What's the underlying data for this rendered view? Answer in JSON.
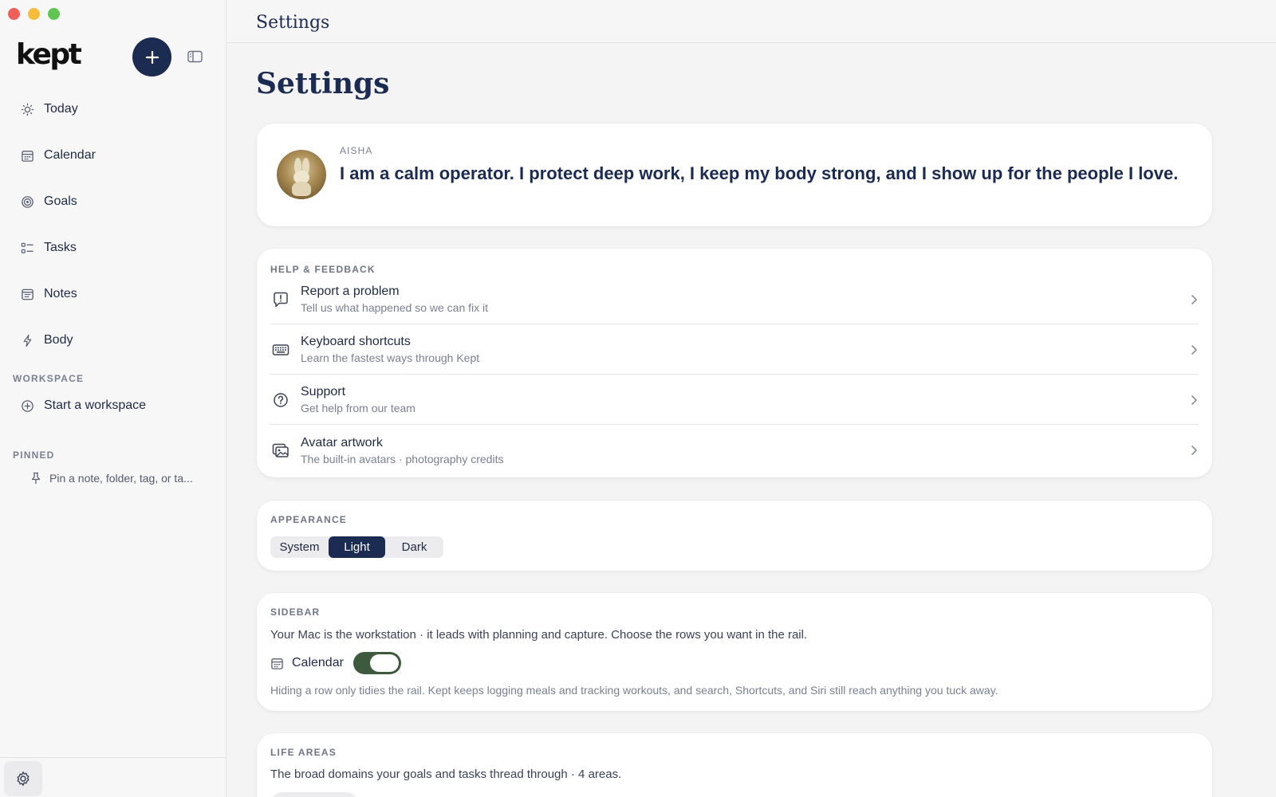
{
  "sidebar": {
    "logo": "kept",
    "nav": [
      {
        "label": "Today",
        "icon": "sun-icon"
      },
      {
        "label": "Calendar",
        "icon": "calendar-icon"
      },
      {
        "label": "Goals",
        "icon": "target-icon"
      },
      {
        "label": "Tasks",
        "icon": "tasks-icon"
      },
      {
        "label": "Notes",
        "icon": "notes-icon"
      },
      {
        "label": "Body",
        "icon": "bolt-icon"
      }
    ],
    "workspace_label": "WORKSPACE",
    "workspace_item": "Start a workspace",
    "pinned_label": "PINNED",
    "pinned_placeholder": "Pin a note, folder, tag, or ta..."
  },
  "header": {
    "title": "Settings"
  },
  "page": {
    "title": "Settings"
  },
  "profile": {
    "name": "AISHA",
    "motto": "I am a calm operator. I protect deep work, I keep my body strong, and I show up for the people I love."
  },
  "help": {
    "label": "HELP & FEEDBACK",
    "rows": [
      {
        "title": "Report a problem",
        "subtitle": "Tell us what happened so we can fix it",
        "icon": "report-icon"
      },
      {
        "title": "Keyboard shortcuts",
        "subtitle": "Learn the fastest ways through Kept",
        "icon": "keyboard-icon"
      },
      {
        "title": "Support",
        "subtitle": "Get help from our team",
        "icon": "help-circle-icon"
      },
      {
        "title": "Avatar artwork",
        "subtitle": "The built-in avatars · photography credits",
        "icon": "images-icon"
      }
    ]
  },
  "appearance": {
    "label": "APPEARANCE",
    "options": [
      "System",
      "Light",
      "Dark"
    ],
    "selected": "Light"
  },
  "sidebar_settings": {
    "label": "SIDEBAR",
    "description": "Your Mac is the workstation · it leads with planning and capture. Choose the rows you want in the rail.",
    "rows": [
      {
        "label": "Calendar",
        "enabled": true
      }
    ],
    "note": "Hiding a row only tidies the rail. Kept keeps logging meals and tracking workouts, and search, Shortcuts, and Siri still reach anything you tuck away."
  },
  "life_areas": {
    "label": "LIFE AREAS",
    "description": "The broad domains your goals and tasks thread through · 4 areas."
  },
  "colors": {
    "accent": "#1c2b52",
    "toggle_on": "#3d5a3f",
    "background": "#f4f4f5"
  }
}
